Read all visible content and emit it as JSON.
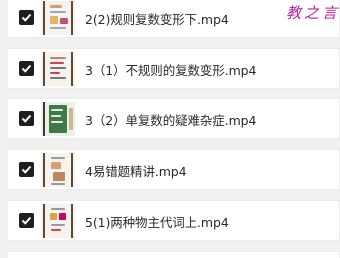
{
  "files": [
    {
      "name": "2(2)规则复数变形下.mp4",
      "checked": true,
      "thumb_style": "a"
    },
    {
      "name": "3（1）不规则的复数变形.mp4",
      "checked": true,
      "thumb_style": "b"
    },
    {
      "name": "3（2）单复数的疑难杂症.mp4",
      "checked": true,
      "thumb_style": "c"
    },
    {
      "name": "4易错题精讲.mp4",
      "checked": true,
      "thumb_style": "d"
    },
    {
      "name": "5(1)两种物主代词上.mp4",
      "checked": true,
      "thumb_style": "e"
    }
  ],
  "watermark": "教之言",
  "colors": {
    "checkbox": "#1f1f1f",
    "watermark": "#c01aa6",
    "row_bg": "#ffffff",
    "page_bg": "#f0f0f0"
  }
}
